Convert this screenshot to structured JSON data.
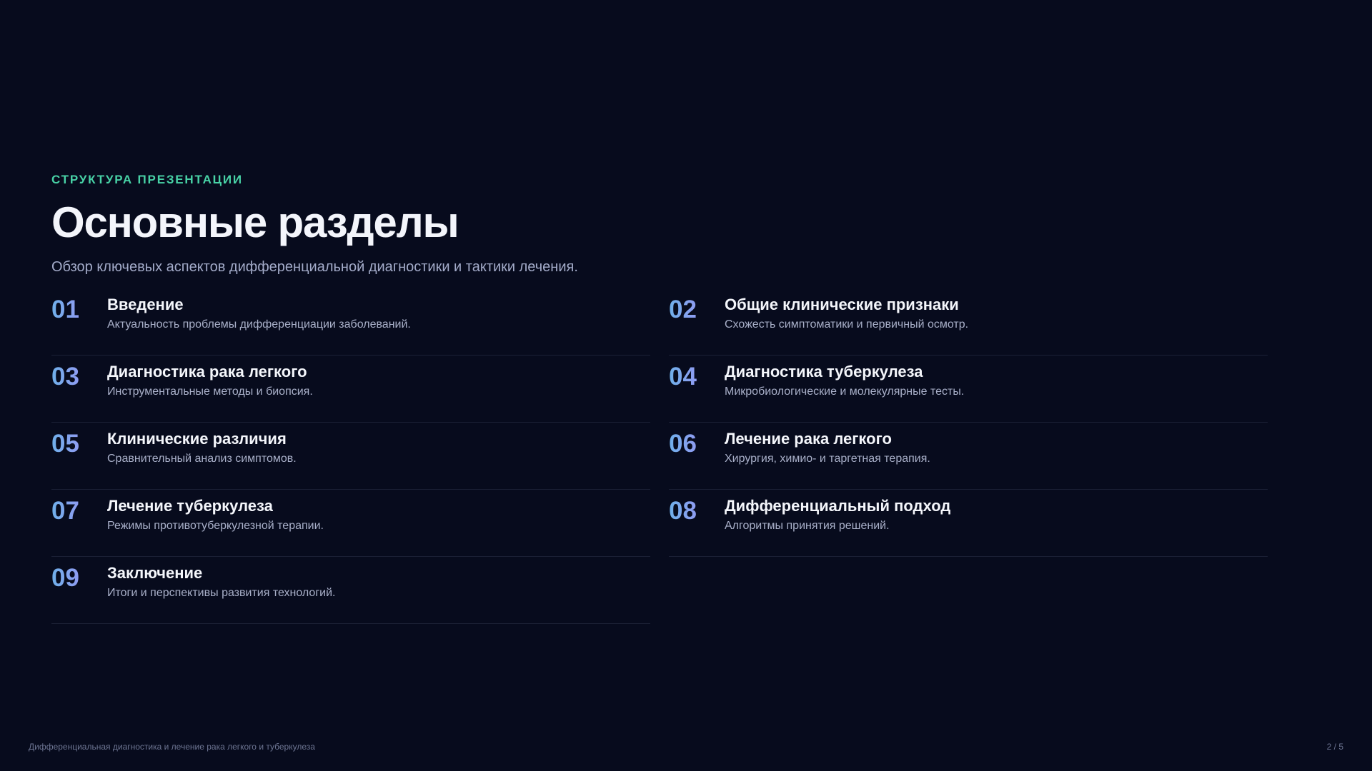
{
  "header": {
    "eyebrow": "СТРУКТУРА ПРЕЗЕНТАЦИИ",
    "title": "Основные разделы",
    "subtitle": "Обзор ключевых аспектов дифференциальной диагностики и тактики лечения."
  },
  "sections": [
    {
      "number": "01",
      "title": "Введение",
      "description": "Актуальность проблемы дифференциации заболеваний."
    },
    {
      "number": "02",
      "title": "Общие клинические признаки",
      "description": "Схожесть симптоматики и первичный осмотр."
    },
    {
      "number": "03",
      "title": "Диагностика рака легкого",
      "description": "Инструментальные методы и биопсия."
    },
    {
      "number": "04",
      "title": "Диагностика туберкулеза",
      "description": "Микробиологические и молекулярные тесты."
    },
    {
      "number": "05",
      "title": "Клинические различия",
      "description": "Сравнительный анализ симптомов."
    },
    {
      "number": "06",
      "title": "Лечение рака легкого",
      "description": "Хирургия, химио- и таргетная терапия."
    },
    {
      "number": "07",
      "title": "Лечение туберкулеза",
      "description": "Режимы противотуберкулезной терапии."
    },
    {
      "number": "08",
      "title": "Дифференциальный подход",
      "description": "Алгоритмы принятия решений."
    },
    {
      "number": "09",
      "title": "Заключение",
      "description": "Итоги и перспективы развития технологий."
    }
  ],
  "footer": {
    "presentation_title": "Дифференциальная диагностика и лечение рака легкого и туберкулеза",
    "page_indicator": "2 / 5"
  },
  "colors": {
    "background": "#070b1d",
    "accent": "#48d2a6",
    "number_gradient_start": "#6fb0ea",
    "number_gradient_end": "#8f9cf2"
  }
}
